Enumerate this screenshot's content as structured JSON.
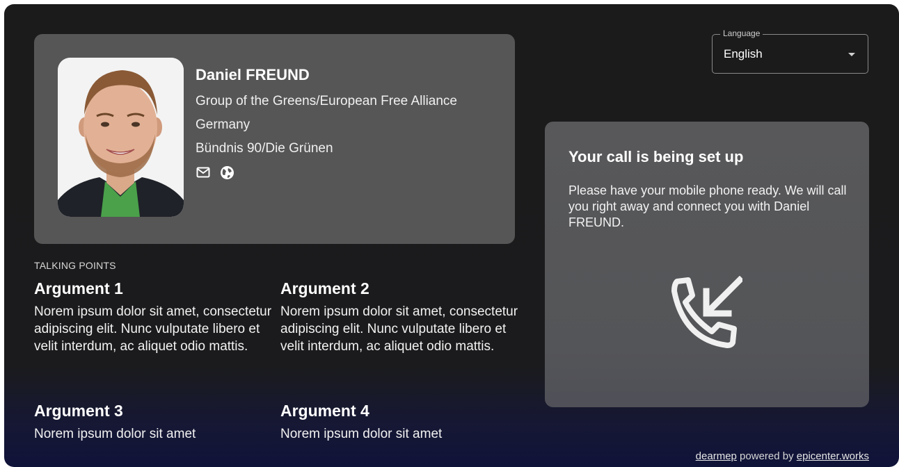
{
  "mep": {
    "name": "Daniel FREUND",
    "group": "Group of the Greens/European Free Alliance",
    "country": "Germany",
    "party": "Bündnis 90/Die Grünen",
    "icons": [
      "mail-icon",
      "globe-icon"
    ]
  },
  "talking_points": {
    "label": "TALKING POINTS",
    "arguments": [
      {
        "title": "Argument 1",
        "text": "Norem ipsum dolor sit amet, consectetur adipiscing elit. Nunc vulputate libero et velit interdum, ac aliquet odio mattis."
      },
      {
        "title": "Argument 2",
        "text": "Norem ipsum dolor sit amet, consectetur adipiscing elit. Nunc vulputate libero et velit interdum, ac aliquet odio mattis."
      },
      {
        "title": "Argument 3",
        "text": "Norem ipsum dolor sit amet"
      },
      {
        "title": "Argument 4",
        "text": "Norem ipsum dolor sit amet"
      }
    ]
  },
  "language": {
    "label": "Language",
    "value": "English"
  },
  "call": {
    "title": "Your call is being set up",
    "text": "Please have your mobile phone ready. We will call you right away and connect you with Daniel FREUND.",
    "icon": "incoming-call-icon"
  },
  "footer": {
    "brand": "dearmep",
    "powered_by": "powered by",
    "org": "epicenter.works"
  },
  "colors": {
    "card": "#565657",
    "background": "#1b1b1c",
    "accent_bottom": "#101339"
  }
}
